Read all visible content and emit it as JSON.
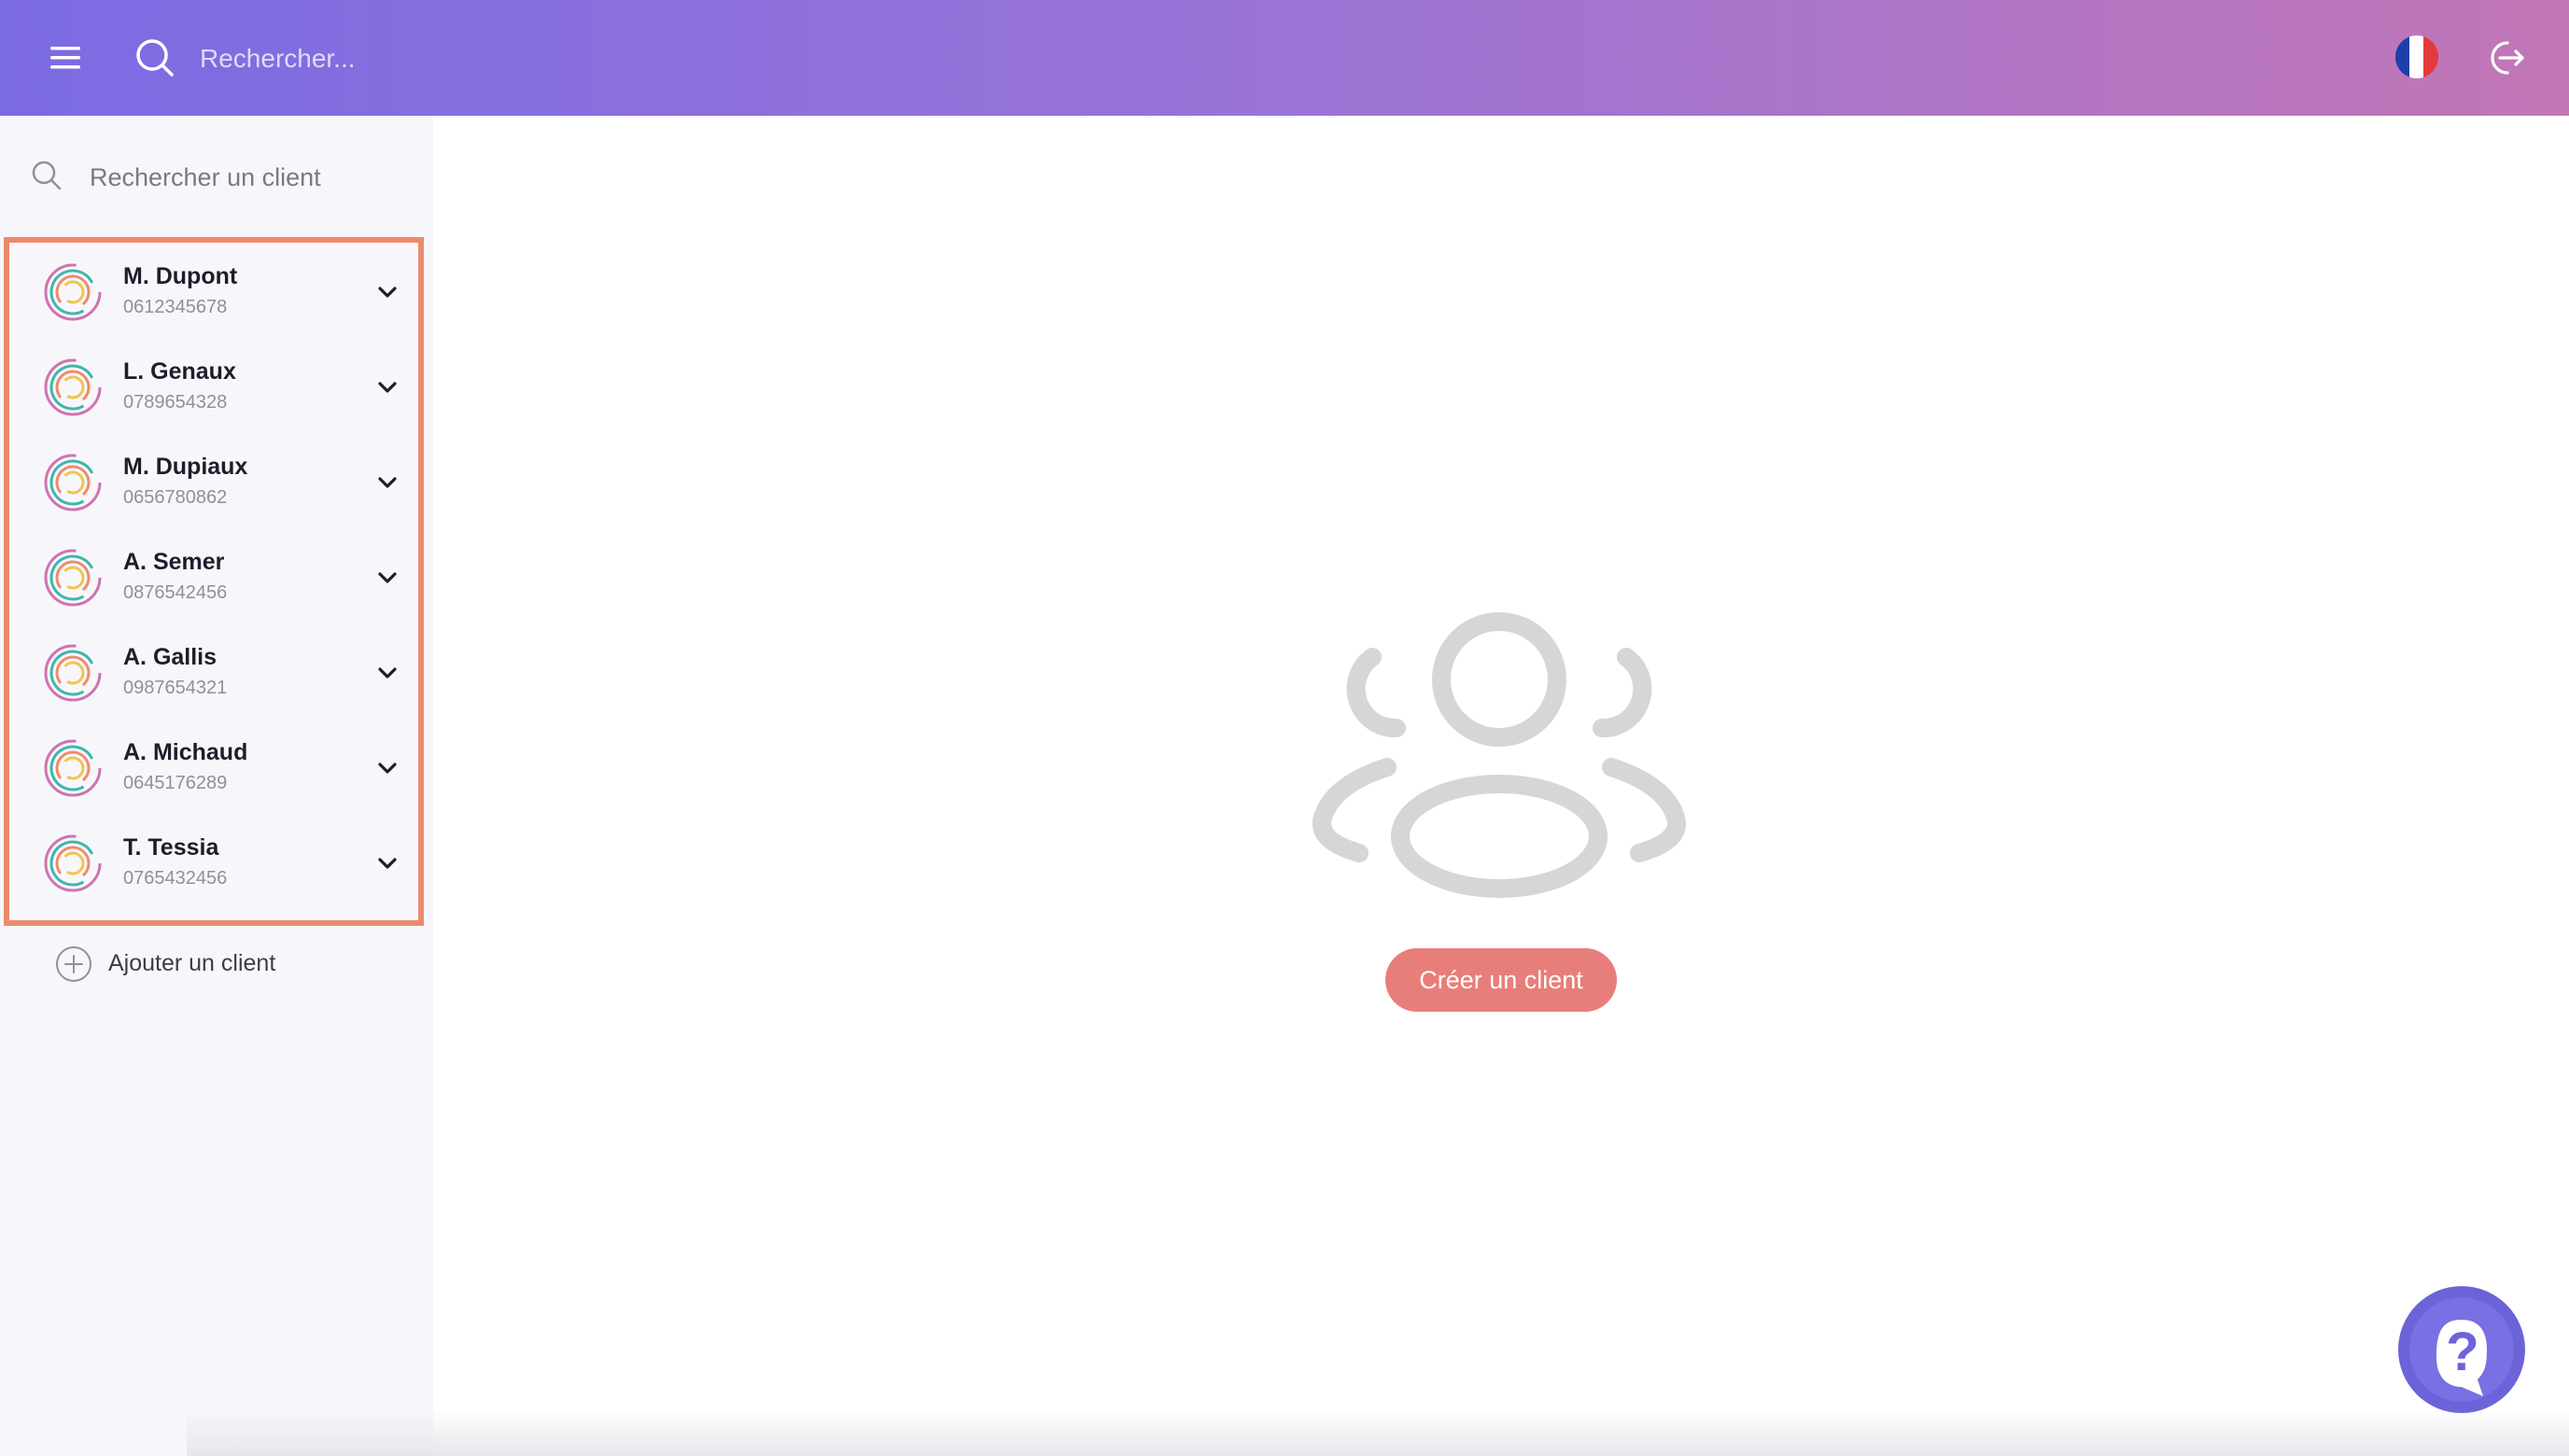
{
  "header": {
    "search_placeholder": "Rechercher...",
    "menu_icon": "hamburger-menu-icon",
    "language_icon": "france-flag-icon",
    "logout_icon": "logout-icon",
    "gradient": [
      "#7b6be3",
      "#c276b6"
    ]
  },
  "sidebar": {
    "search_placeholder": "Rechercher un client",
    "clients": [
      {
        "name": "M. Dupont",
        "phone": "0612345678"
      },
      {
        "name": "L. Genaux",
        "phone": "0789654328"
      },
      {
        "name": "M. Dupiaux",
        "phone": "0656780862"
      },
      {
        "name": "A. Semer",
        "phone": "0876542456"
      },
      {
        "name": "A. Gallis",
        "phone": "0987654321"
      },
      {
        "name": "A. Michaud",
        "phone": "0645176289"
      },
      {
        "name": "T. Tessia",
        "phone": "0765432456"
      }
    ],
    "add_client_label": "Ajouter un client",
    "highlight_color": "#ec8a6c"
  },
  "main": {
    "empty_icon": "users-group-icon",
    "create_button_label": "Créer un client",
    "create_button_color": "#e87e7a"
  },
  "help": {
    "icon": "help-question-icon",
    "color": "#6c63d9"
  }
}
